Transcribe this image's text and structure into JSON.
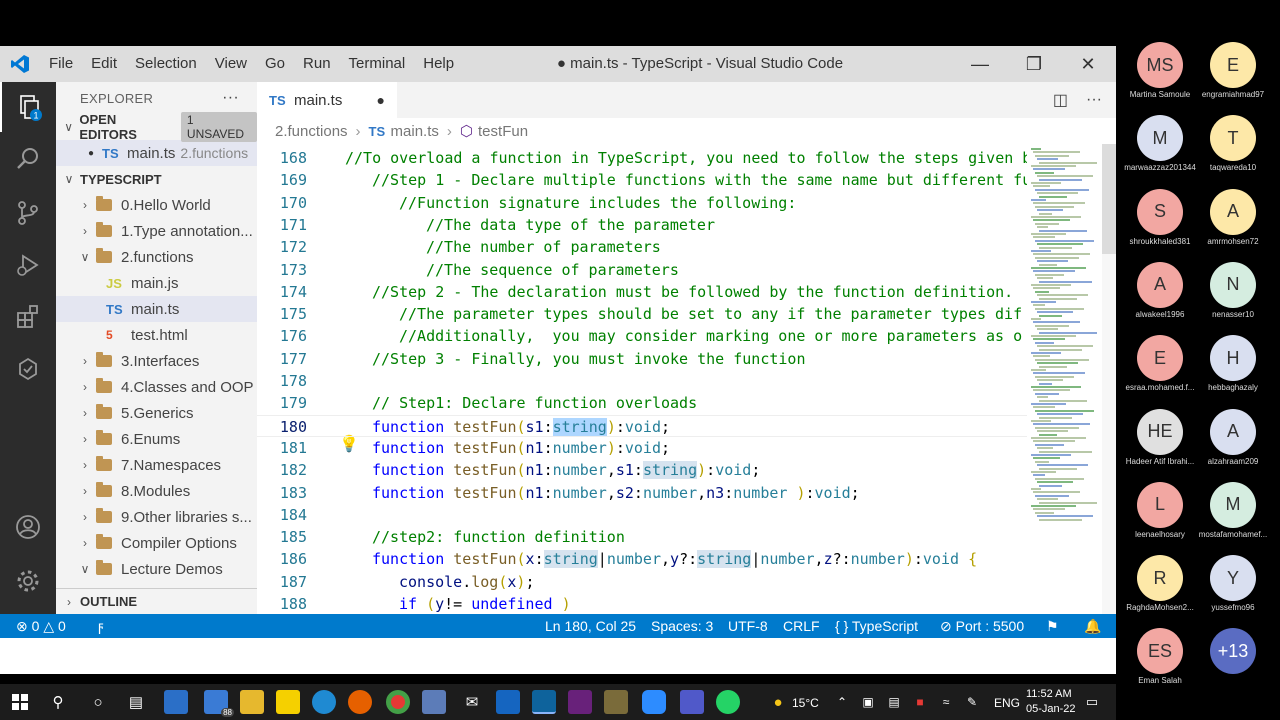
{
  "window": {
    "title": "● main.ts - TypeScript - Visual Studio Code",
    "menu": [
      "File",
      "Edit",
      "Selection",
      "View",
      "Go",
      "Run",
      "Terminal",
      "Help"
    ]
  },
  "sidebar": {
    "header": "EXPLORER",
    "open_editors_label": "OPEN EDITORS",
    "unsaved_badge": "1 UNSAVED",
    "open_editor_file": "main.ts",
    "open_editor_folder": "2.functions",
    "project_label": "TYPESCRIPT",
    "outline_label": "OUTLINE",
    "tree": [
      {
        "label": "0.Hello World",
        "kind": "folder",
        "expanded": false
      },
      {
        "label": "1.Type annotation...",
        "kind": "folder",
        "expanded": false
      },
      {
        "label": "2.functions",
        "kind": "folder",
        "expanded": true
      },
      {
        "label": "main.js",
        "kind": "js",
        "icon": "JS"
      },
      {
        "label": "main.ts",
        "kind": "ts",
        "icon": "TS"
      },
      {
        "label": "test.html",
        "kind": "html",
        "icon": "5"
      },
      {
        "label": "3.Interfaces",
        "kind": "folder",
        "expanded": false
      },
      {
        "label": "4.Classes and OOP",
        "kind": "folder",
        "expanded": false
      },
      {
        "label": "5.Generics",
        "kind": "folder",
        "expanded": false
      },
      {
        "label": "6.Enums",
        "kind": "folder",
        "expanded": false
      },
      {
        "label": "7.Namespaces",
        "kind": "folder",
        "expanded": false
      },
      {
        "label": "8.Modules",
        "kind": "folder",
        "expanded": false
      },
      {
        "label": "9.Other libraries s...",
        "kind": "folder",
        "expanded": false
      },
      {
        "label": "Compiler Options",
        "kind": "folder",
        "expanded": false
      },
      {
        "label": "Lecture Demos",
        "kind": "folder",
        "expanded": true
      }
    ]
  },
  "editor": {
    "tab_label": "main.ts",
    "tab_icon": "TS",
    "breadcrumb": [
      "2.functions",
      "main.ts",
      "testFun"
    ],
    "active_line": 180,
    "lines": [
      {
        "n": "168",
        "indent": 0,
        "tokens": [
          [
            "cm",
            "//To overload a function in TypeScript, you need to follow the steps given b"
          ]
        ]
      },
      {
        "n": "169",
        "indent": 1,
        "tokens": [
          [
            "cm",
            "//Step 1 - Declare multiple functions with the same name but different fu"
          ]
        ]
      },
      {
        "n": "170",
        "indent": 2,
        "tokens": [
          [
            "cm",
            "//Function signature includes the following:"
          ]
        ]
      },
      {
        "n": "171",
        "indent": 3,
        "tokens": [
          [
            "cm",
            "//The data type of the parameter"
          ]
        ]
      },
      {
        "n": "172",
        "indent": 3,
        "tokens": [
          [
            "cm",
            "//The number of parameters"
          ]
        ]
      },
      {
        "n": "173",
        "indent": 3,
        "tokens": [
          [
            "cm",
            "//The sequence of parameters"
          ]
        ]
      },
      {
        "n": "174",
        "indent": 1,
        "tokens": [
          [
            "cm",
            "//Step 2 - The declaration must be followed by the function definition."
          ]
        ]
      },
      {
        "n": "175",
        "indent": 2,
        "tokens": [
          [
            "cm",
            "//The parameter types should be set to any if the parameter types dif"
          ]
        ]
      },
      {
        "n": "176",
        "indent": 2,
        "tokens": [
          [
            "cm",
            "//Additionally,  you may consider marking one or more parameters as o"
          ]
        ]
      },
      {
        "n": "177",
        "indent": 1,
        "tokens": [
          [
            "cm",
            "//Step 3 - Finally, you must invoke the function"
          ]
        ]
      },
      {
        "n": "178",
        "indent": 0,
        "tokens": []
      },
      {
        "n": "179",
        "indent": 1,
        "tokens": [
          [
            "cm",
            "// Step1: Declare function overloads"
          ]
        ]
      },
      {
        "n": "180",
        "indent": 1,
        "tokens": [
          [
            "kw",
            "function "
          ],
          [
            "fn",
            "testFun"
          ],
          [
            "br",
            "("
          ],
          [
            "pm",
            "s1"
          ],
          [
            "",
            ":"
          ],
          [
            "ty hl",
            "string"
          ],
          [
            "br",
            ")"
          ],
          [
            "",
            ":"
          ],
          [
            "ty",
            "void"
          ],
          [
            "",
            ";"
          ]
        ]
      },
      {
        "n": "181",
        "indent": 1,
        "tokens": [
          [
            "kw",
            "function "
          ],
          [
            "fn",
            "testFun"
          ],
          [
            "br",
            "("
          ],
          [
            "pm",
            "n1"
          ],
          [
            "",
            ":"
          ],
          [
            "ty",
            "number"
          ],
          [
            "br",
            ")"
          ],
          [
            "",
            ":"
          ],
          [
            "ty",
            "void"
          ],
          [
            "",
            ";"
          ]
        ]
      },
      {
        "n": "182",
        "indent": 1,
        "tokens": [
          [
            "kw",
            "function "
          ],
          [
            "fn",
            "testFun"
          ],
          [
            "br",
            "("
          ],
          [
            "pm",
            "n1"
          ],
          [
            "",
            ":"
          ],
          [
            "ty",
            "number"
          ],
          [
            "",
            ","
          ],
          [
            "pm",
            "s1"
          ],
          [
            "",
            ":"
          ],
          [
            "ty hl2",
            "string"
          ],
          [
            "br",
            ")"
          ],
          [
            "",
            ":"
          ],
          [
            "ty",
            "void"
          ],
          [
            "",
            ";"
          ]
        ]
      },
      {
        "n": "183",
        "indent": 1,
        "tokens": [
          [
            "kw",
            "function "
          ],
          [
            "fn",
            "testFun"
          ],
          [
            "br",
            "("
          ],
          [
            "pm",
            "n1"
          ],
          [
            "",
            ":"
          ],
          [
            "ty",
            "number"
          ],
          [
            "",
            ","
          ],
          [
            "pm",
            "s2"
          ],
          [
            "",
            ":"
          ],
          [
            "ty",
            "number"
          ],
          [
            "",
            ","
          ],
          [
            "pm",
            "n3"
          ],
          [
            "",
            ":"
          ],
          [
            "ty",
            "number "
          ],
          [
            "br",
            ")"
          ],
          [
            "",
            ":"
          ],
          [
            "ty",
            "void"
          ],
          [
            "",
            ";"
          ]
        ]
      },
      {
        "n": "184",
        "indent": 0,
        "tokens": []
      },
      {
        "n": "185",
        "indent": 1,
        "tokens": [
          [
            "cm",
            "//step2: function definition"
          ]
        ]
      },
      {
        "n": "186",
        "indent": 1,
        "tokens": [
          [
            "kw",
            "function "
          ],
          [
            "fn",
            "testFun"
          ],
          [
            "br",
            "("
          ],
          [
            "pm",
            "x"
          ],
          [
            "",
            ":"
          ],
          [
            "ty hl2",
            "string"
          ],
          [
            "",
            "|"
          ],
          [
            "ty",
            "number"
          ],
          [
            "",
            ","
          ],
          [
            "pm",
            "y"
          ],
          [
            "",
            "?:"
          ],
          [
            "ty hl2",
            "string"
          ],
          [
            "",
            "|"
          ],
          [
            "ty",
            "number"
          ],
          [
            "",
            ","
          ],
          [
            "pm",
            "z"
          ],
          [
            "",
            "?:"
          ],
          [
            "ty",
            "number"
          ],
          [
            "br",
            ")"
          ],
          [
            "",
            ":"
          ],
          [
            "ty",
            "void "
          ],
          [
            "br",
            "{"
          ]
        ]
      },
      {
        "n": "187",
        "indent": 2,
        "tokens": [
          [
            "pm",
            "console"
          ],
          [
            "",
            "."
          ],
          [
            "fn",
            "log"
          ],
          [
            "br",
            "("
          ],
          [
            "pm",
            "x"
          ],
          [
            "br",
            ")"
          ],
          [
            "",
            ";"
          ]
        ]
      },
      {
        "n": "188",
        "indent": 2,
        "tokens": [
          [
            "kw",
            "if "
          ],
          [
            "br",
            "("
          ],
          [
            "pm",
            "y"
          ],
          [
            "",
            "!= "
          ],
          [
            "kw",
            "undefined "
          ],
          [
            "br",
            ")"
          ]
        ]
      }
    ]
  },
  "statusbar": {
    "errors": "0",
    "warnings": "0",
    "position": "Ln 180, Col 25",
    "spaces": "Spaces: 3",
    "encoding": "UTF-8",
    "eol": "CRLF",
    "language": "TypeScript",
    "port": "Port : 5500"
  },
  "taskbar": {
    "weather": "15°C",
    "lang": "ENG",
    "time": "11:52 AM",
    "date": "05-Jan-22",
    "mail_badge": "88"
  },
  "participants": [
    {
      "initials": "MS",
      "name": "Martina Samoule",
      "color": "#f2a7a2"
    },
    {
      "initials": "E",
      "name": "engramiahmad97",
      "color": "#fde8a8"
    },
    {
      "initials": "M",
      "name": "marwaazzaz201344",
      "color": "#d9dff0"
    },
    {
      "initials": "T",
      "name": "taqwareda10",
      "color": "#fde8a8"
    },
    {
      "initials": "S",
      "name": "shroukkhaled381",
      "color": "#f2a7a2"
    },
    {
      "initials": "A",
      "name": "amrmohsen72",
      "color": "#fde8a8"
    },
    {
      "initials": "A",
      "name": "alwakeel1996",
      "color": "#f2a7a2"
    },
    {
      "initials": "N",
      "name": "nenasser10",
      "color": "#d5ede0"
    },
    {
      "initials": "E",
      "name": "esraa.mohamed.f...",
      "color": "#f2a7a2"
    },
    {
      "initials": "H",
      "name": "hebbaghazaly",
      "color": "#d9dff0"
    },
    {
      "initials": "HE",
      "name": "Hadeer Atif Ibrahi...",
      "color": "#e0e0e0"
    },
    {
      "initials": "A",
      "name": "alzahraam209",
      "color": "#d9dff0"
    },
    {
      "initials": "L",
      "name": "leenaelhosary",
      "color": "#f2a7a2"
    },
    {
      "initials": "M",
      "name": "mostafamohamef...",
      "color": "#d5ede0"
    },
    {
      "initials": "R",
      "name": "RaghdaMohsen2...",
      "color": "#fde8a8"
    },
    {
      "initials": "Y",
      "name": "yussefmo96",
      "color": "#d9dff0"
    },
    {
      "initials": "ES",
      "name": "Eman Salah",
      "color": "#f2a7a2"
    },
    {
      "initials": "+13",
      "name": "",
      "color": "#5a6cc2"
    }
  ]
}
